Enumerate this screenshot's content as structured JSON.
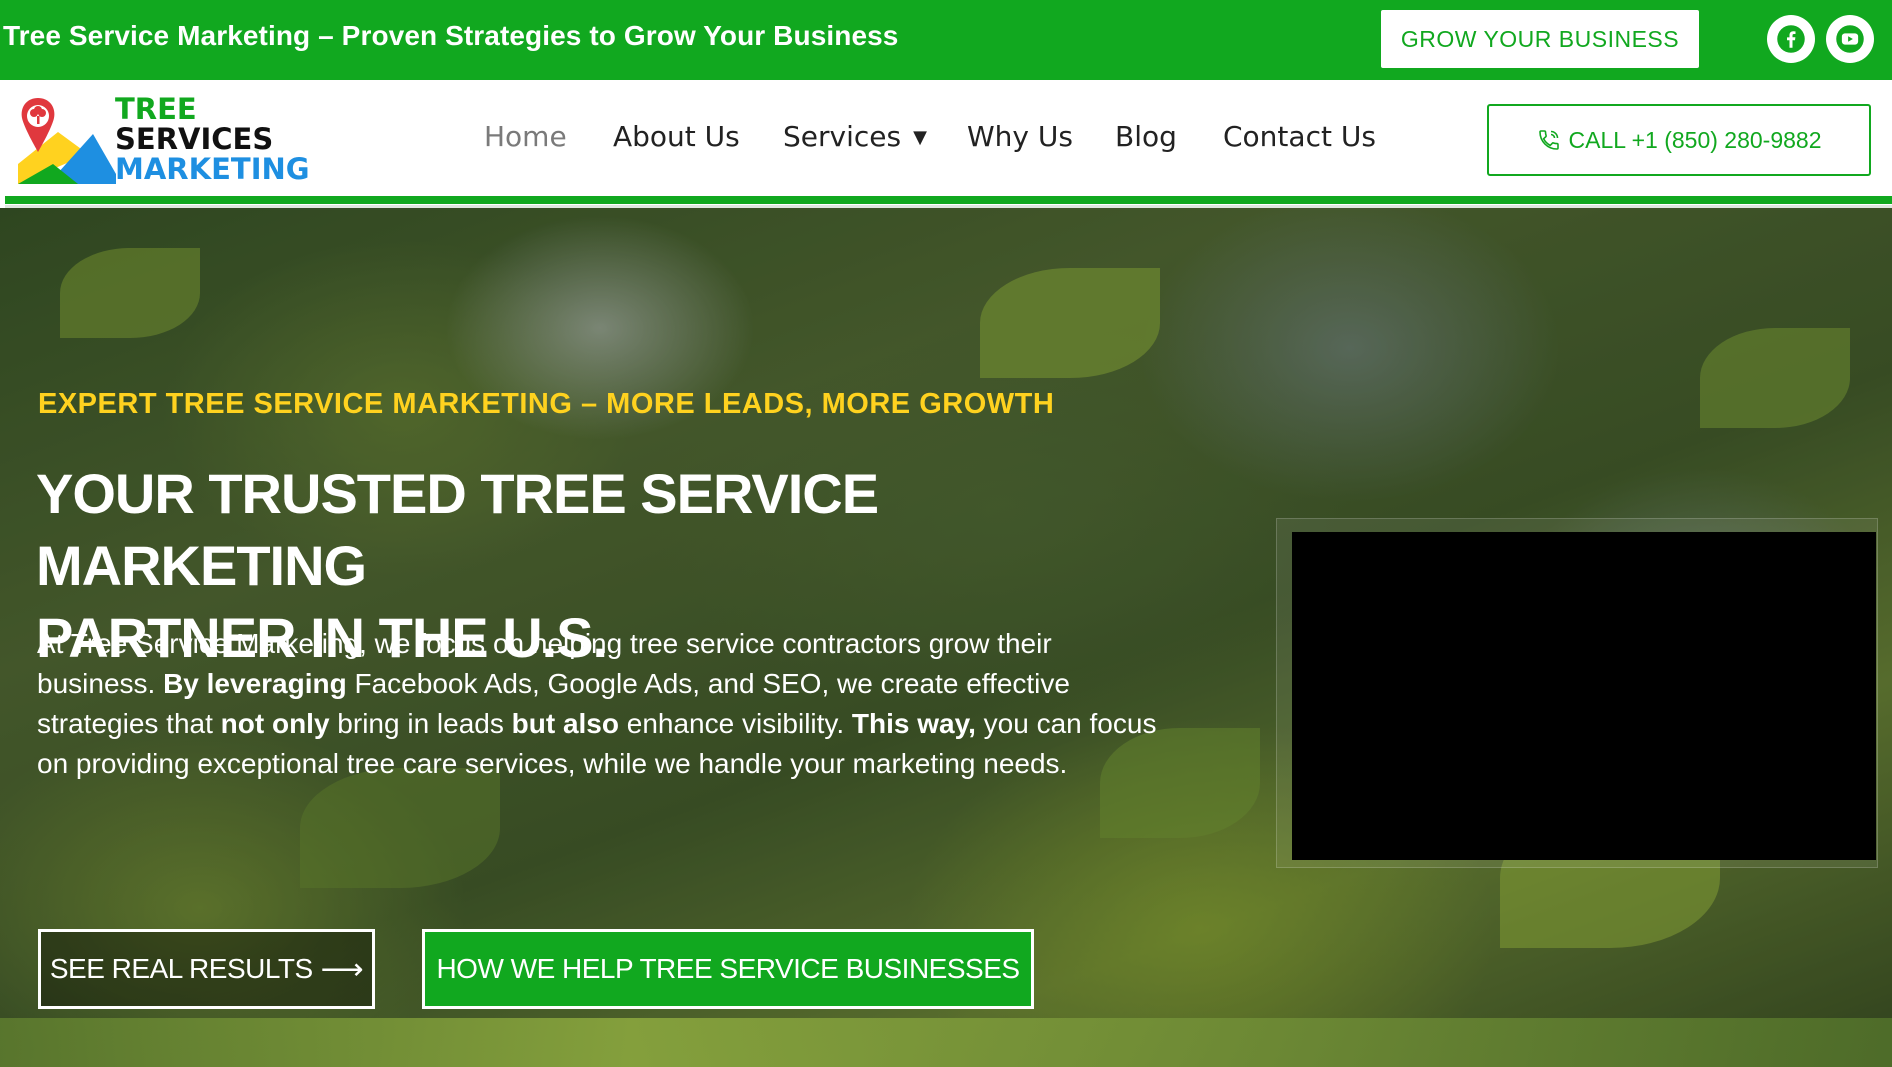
{
  "topbar": {
    "title": "Tree Service Marketing – Proven Strategies to Grow Your Business",
    "grow_button": "GROW YOUR BUSINESS",
    "social": [
      {
        "icon": "facebook-icon"
      },
      {
        "icon": "youtube-icon"
      }
    ]
  },
  "brand": {
    "line1": "TREE",
    "line2": "SERVICES",
    "line3": "MARKETING",
    "colors": {
      "green": "#11a81f",
      "blue": "#1e8fe1",
      "yellow": "#ffd21f",
      "red": "#e0383e"
    }
  },
  "nav": {
    "items": [
      {
        "label": "Home",
        "active": true
      },
      {
        "label": "About Us"
      },
      {
        "label": "Services",
        "has_dropdown": true
      },
      {
        "label": "Why Us"
      },
      {
        "label": "Blog"
      },
      {
        "label": "Contact Us"
      }
    ],
    "call_button": "CALL +1 (850) 280-9882"
  },
  "hero": {
    "tagline": "EXPERT TREE SERVICE MARKETING – MORE LEADS, MORE GROWTH",
    "title_line1": "YOUR TRUSTED TREE SERVICE MARKETING",
    "title_line2": "PARTNER IN THE U.S.",
    "body": {
      "p1": "At Tree Service Marketing, we focus on helping tree service contractors grow their business. ",
      "b1": "By leveraging",
      "p2": " Facebook Ads, Google Ads, and SEO, we create effective strategies that ",
      "b2": "not only",
      "p3": " bring in leads ",
      "b3": "but also",
      "p4": " enhance visibility. ",
      "b4": "This way,",
      "p5": " you can focus on providing exceptional tree care services, while we handle your marketing needs."
    },
    "btn_results": "SEE REAL RESULTS",
    "btn_help": "HOW WE HELP TREE SERVICE BUSINESSES"
  }
}
